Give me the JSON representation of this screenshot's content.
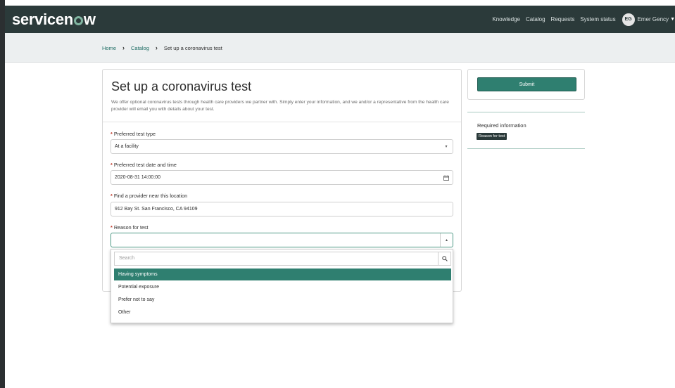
{
  "app": {
    "logo": "servicenow"
  },
  "nav": {
    "items": [
      "Knowledge",
      "Catalog",
      "Requests",
      "System status"
    ],
    "user_initials": "EG",
    "user_name": "Emer Gency"
  },
  "breadcrumb": {
    "items": [
      "Home",
      "Catalog",
      "Set up a coronavirus test"
    ]
  },
  "form": {
    "title": "Set up a coronavirus test",
    "description": "We offer optional coronavirus tests through health care providers we partner with. Simply enter your information, and we and/or a representative from the health care provider will email you with details about your test.",
    "fields": [
      {
        "label": "Preferred test type",
        "value": "At a facility"
      },
      {
        "label": "Preferred test date and time",
        "value": "2020-08-31 14:00:00"
      },
      {
        "label": "Find a provider near this location",
        "value": "912 Bay St. San Francisco, CA 94109"
      },
      {
        "label": "Reason for test",
        "value": ""
      }
    ]
  },
  "dropdown": {
    "search_placeholder": "Search",
    "options": [
      "Having symptoms",
      "Potential exposure",
      "Prefer not to say",
      "Other"
    ],
    "selected_index": 0
  },
  "sidebar": {
    "submit_label": "Submit",
    "required_title": "Required information",
    "required_badge": "Reason for test"
  },
  "colors": {
    "brand_dark": "#2b3a3a",
    "accent": "#2f7f70",
    "logo_o": "#81b5a1"
  }
}
